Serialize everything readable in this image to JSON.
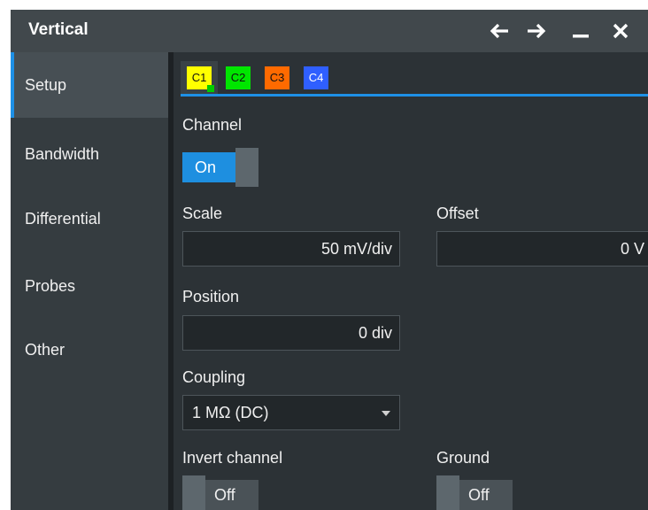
{
  "window": {
    "title": "Vertical",
    "controls": [
      "arrow-left-icon",
      "arrow-right-icon",
      "minimize-icon",
      "close-icon"
    ]
  },
  "sidebar": {
    "items": [
      {
        "label": "Setup",
        "active": true
      },
      {
        "label": "Bandwidth",
        "active": false
      },
      {
        "label": "Differential",
        "active": false
      },
      {
        "label": "Probes",
        "active": false
      },
      {
        "label": "Other",
        "active": false
      }
    ]
  },
  "tabs": [
    {
      "label": "C1",
      "color": "#ffff00",
      "active": true
    },
    {
      "label": "C2",
      "color": "#00e600",
      "active": false
    },
    {
      "label": "C3",
      "color": "#ff6a00",
      "active": false
    },
    {
      "label": "C4",
      "color": "#2f5fff",
      "active": false
    }
  ],
  "form": {
    "channel": {
      "label": "Channel",
      "state": "On"
    },
    "scale": {
      "label": "Scale",
      "value": "50 mV/div"
    },
    "offset": {
      "label": "Offset",
      "value": "0 V"
    },
    "position": {
      "label": "Position",
      "value": "0 div"
    },
    "coupling": {
      "label": "Coupling",
      "value": "1 MΩ (DC)"
    },
    "invert": {
      "label": "Invert channel",
      "state": "Off"
    },
    "ground": {
      "label": "Ground",
      "state": "Off"
    }
  },
  "colors": {
    "accent": "#1e90e6",
    "titlebar": "#41484c",
    "sidebar": "#353c40",
    "content": "#2c3236"
  }
}
